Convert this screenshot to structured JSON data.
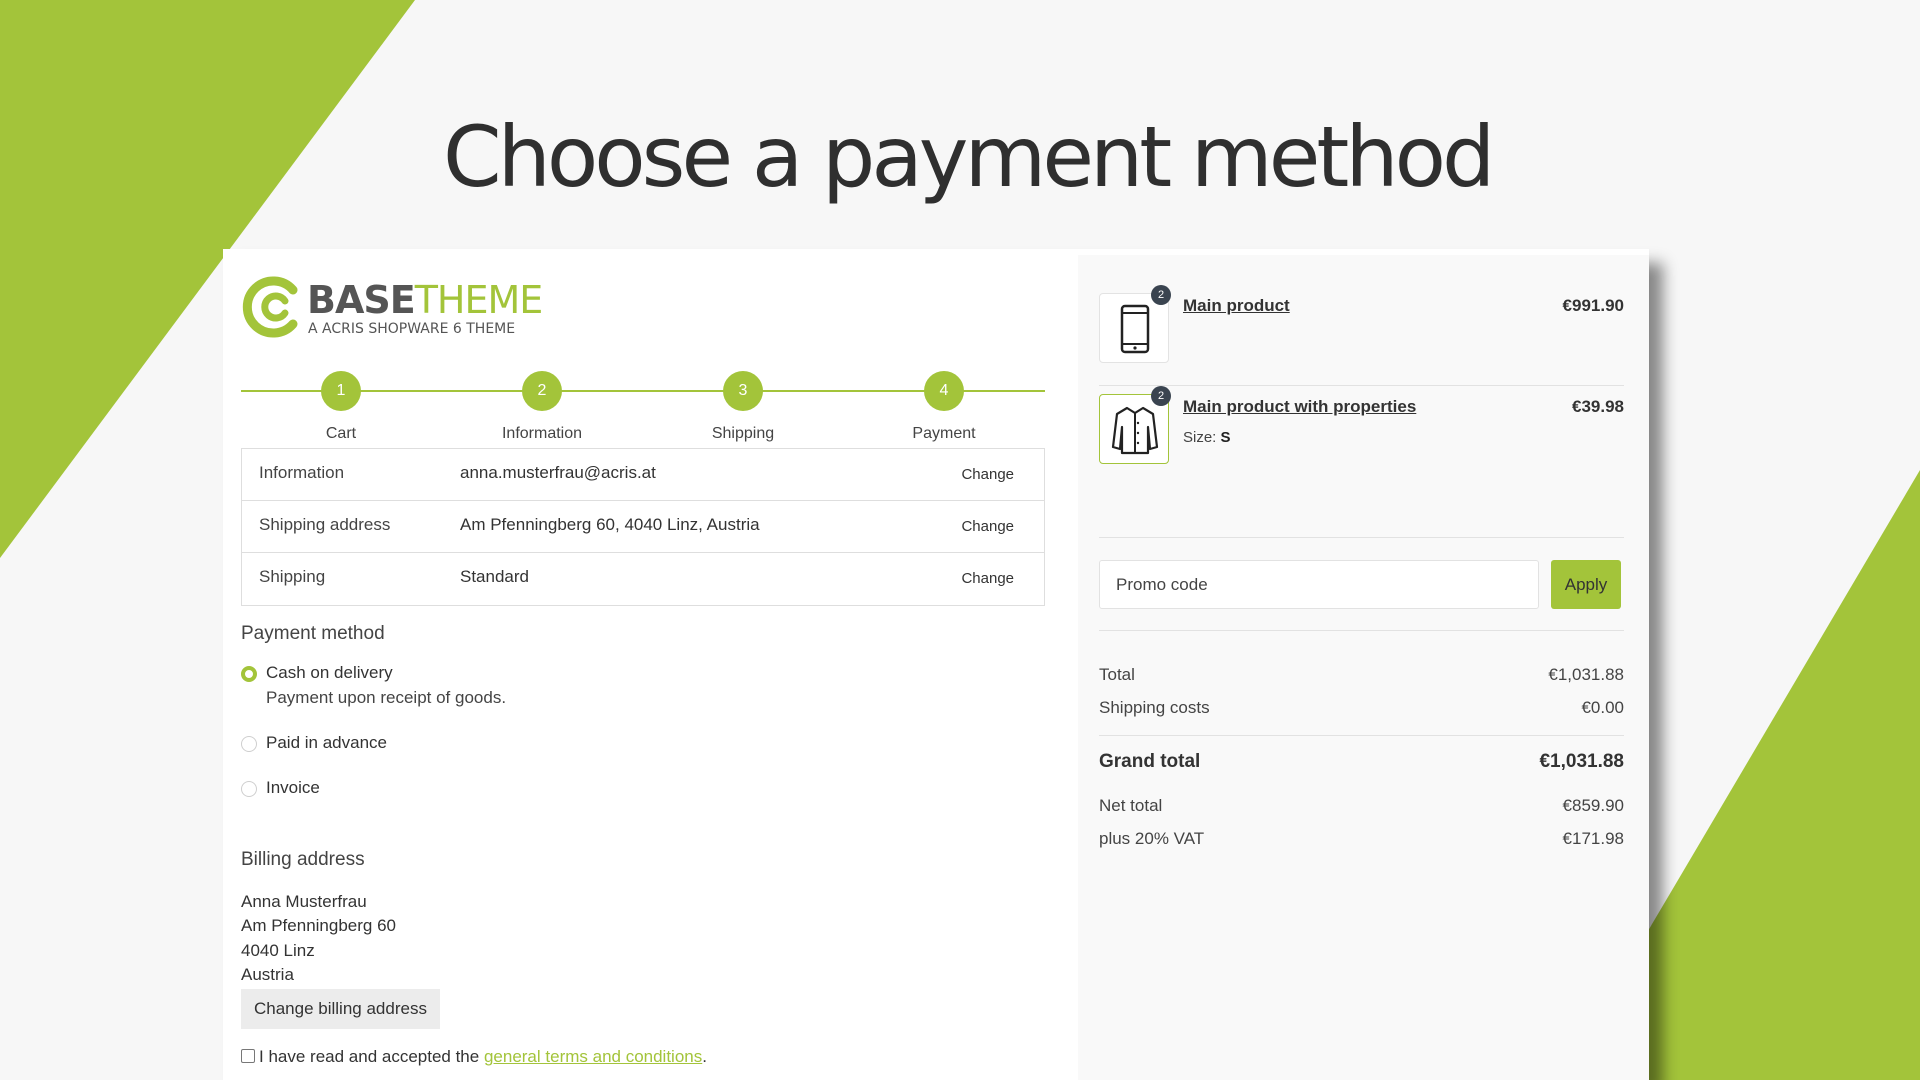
{
  "slide": {
    "title": "Choose a payment method"
  },
  "brand": {
    "logo_word_bold": "BASE",
    "logo_word_light": "THEME",
    "logo_sub": "A ACRIS SHOPWARE 6 THEME",
    "accent": "#a3c43a"
  },
  "steps": [
    {
      "number": "1",
      "label": "Cart"
    },
    {
      "number": "2",
      "label": "Information"
    },
    {
      "number": "3",
      "label": "Shipping"
    },
    {
      "number": "4",
      "label": "Payment"
    }
  ],
  "summary": [
    {
      "key": "Information",
      "value": "anna.musterfrau@acris.at",
      "action": "Change"
    },
    {
      "key": "Shipping address",
      "value": "Am Pfenningberg 60, 4040 Linz, Austria",
      "action": "Change"
    },
    {
      "key": "Shipping",
      "value": "Standard",
      "action": "Change"
    }
  ],
  "payment": {
    "title": "Payment method",
    "options": [
      {
        "label": "Cash on delivery",
        "description": "Payment upon receipt of goods.",
        "selected": true
      },
      {
        "label": "Paid in advance",
        "selected": false
      },
      {
        "label": "Invoice",
        "selected": false
      }
    ]
  },
  "billing": {
    "title": "Billing address",
    "lines": [
      "Anna Musterfrau",
      "Am Pfenningberg 60",
      "4040 Linz",
      "Austria"
    ],
    "change_label": "Change billing address"
  },
  "terms": {
    "prefix": "I have read and accepted the ",
    "link": "general terms and conditions",
    "suffix": "."
  },
  "cart": {
    "items": [
      {
        "name": "Main product",
        "price": "€991.90",
        "qty": "2",
        "icon": "smartphone-icon"
      },
      {
        "name": "Main product with properties",
        "price": "€39.98",
        "qty": "2",
        "icon": "jacket-icon",
        "prop_label": "Size: ",
        "prop_value": "S"
      }
    ],
    "promo_placeholder": "Promo code",
    "promo_button": "Apply"
  },
  "totals": {
    "total_label": "Total",
    "total": "€1,031.88",
    "shipping_label": "Shipping costs",
    "shipping": "€0.00",
    "grand_label": "Grand total",
    "grand": "€1,031.88",
    "net_label": "Net total",
    "net": "€859.90",
    "vat_label": "plus 20% VAT",
    "vat": "€171.98"
  }
}
